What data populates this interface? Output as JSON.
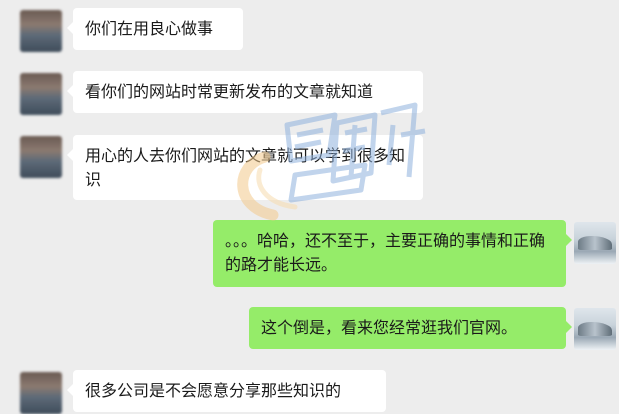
{
  "colors": {
    "background": "#ededed",
    "incoming_bubble": "#ffffff",
    "outgoing_bubble": "#95ec69",
    "watermark_blue": "#8fb2de",
    "watermark_orange": "#f3c98b"
  },
  "messages": [
    {
      "side": "left",
      "text": "你们在用良心做事"
    },
    {
      "side": "left",
      "text": "看你们的网站时常更新发布的文章就知道"
    },
    {
      "side": "left",
      "text": "用心的人去你们网站的文章就可以学到很多知识"
    },
    {
      "side": "right",
      "text": "。。。哈哈，还不至于，主要正确的事情和正确的路才能长远。"
    },
    {
      "side": "right",
      "text": "这个倒是，看来您经常逛我们官网。"
    },
    {
      "side": "left",
      "text": "很多公司是不会愿意分享那些知识的"
    }
  ]
}
